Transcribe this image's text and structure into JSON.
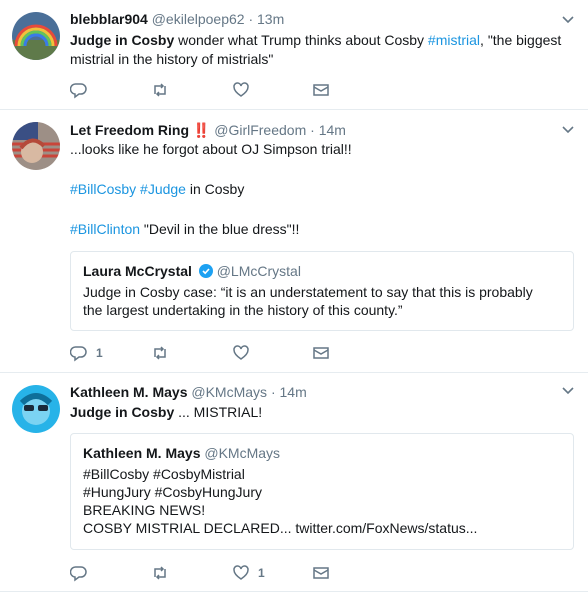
{
  "tweets": [
    {
      "name": "blebblar904",
      "handle": "@ekilelpoep62",
      "time": "13m",
      "text_parts": [
        "Judge in Cosby",
        " wonder what Trump thinks about Cosby ",
        "#mistrial",
        ", \"the biggest",
        "mistrial in the history of mistrials\""
      ],
      "reply_count": "",
      "like_count": ""
    },
    {
      "name": "Let Freedom Ring",
      "name_emoji": "‼️",
      "handle": "@GirlFreedom",
      "time": "14m",
      "line1": "...looks like he forgot about OJ Simpson trial!!",
      "line2_tag1": "#BillCosby",
      "line2_tag2": "#Judge",
      "line2_rest": " in Cosby",
      "line3_tag": "#BillClinton",
      "line3_rest": " \"Devil in the blue dress\"!!",
      "quote": {
        "name": "Laura McCrystal",
        "handle": "@LMcCrystal",
        "text1": "Judge in Cosby case: “it is an understatement to say that this is probably",
        "text2": "the largest undertaking in the history of this county.”"
      },
      "reply_count": "1",
      "like_count": ""
    },
    {
      "name": "Kathleen M. Mays",
      "handle": "@KMcMays",
      "time": "14m",
      "text_bold": "Judge in Cosby",
      "text_rest": " ... MISTRIAL!",
      "quote": {
        "name": "Kathleen M. Mays",
        "handle": "@KMcMays",
        "line1": "#BillCosby #CosbyMistrial",
        "line2": "#HungJury #CosbyHungJury",
        "line3": "BREAKING NEWS!",
        "line4": "COSBY MISTRIAL DECLARED... twitter.com/FoxNews/status..."
      },
      "reply_count": "",
      "like_count": "1"
    }
  ],
  "dot": "·",
  "colors": {
    "link": "#1b95e0",
    "meta": "#657786",
    "border": "#e6ecf0"
  }
}
